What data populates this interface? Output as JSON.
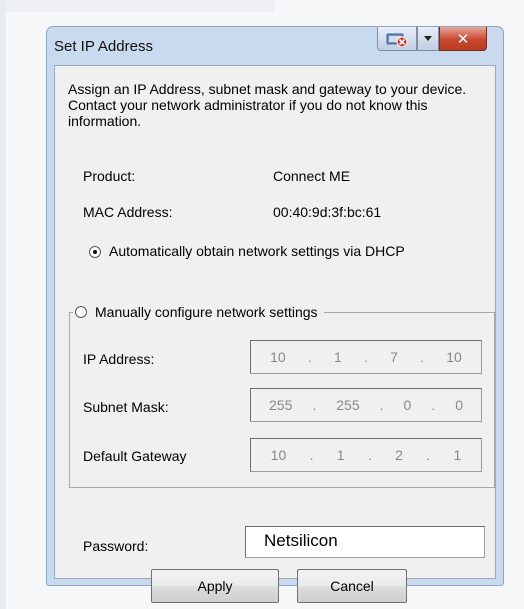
{
  "window": {
    "title": "Set IP Address"
  },
  "description": "Assign an IP Address, subnet mask and gateway to your device.  Contact your network administrator if you do not know this information.",
  "device": {
    "product_label": "Product:",
    "product_value": "Connect ME",
    "mac_label": "MAC Address:",
    "mac_value": "00:40:9d:3f:bc:61"
  },
  "dhcp_option": {
    "label": "Automatically obtain network settings via DHCP",
    "checked": true
  },
  "manual_option": {
    "label": "Manually configure network settings",
    "checked": false
  },
  "network": {
    "ip_label": "IP Address:",
    "ip_octets": [
      "10",
      "1",
      "7",
      "10"
    ],
    "subnet_label": "Subnet Mask:",
    "subnet_octets": [
      "255",
      "255",
      "0",
      "0"
    ],
    "gateway_label": "Default Gateway",
    "gateway_octets": [
      "10",
      "1",
      "2",
      "1"
    ]
  },
  "password": {
    "label": "Password:",
    "value": "Netsilicon"
  },
  "buttons": {
    "apply": "Apply",
    "cancel": "Cancel"
  },
  "icons": {
    "disconnect": "network-disconnect-icon",
    "dropdown": "dropdown-arrow-icon",
    "close": "close-icon"
  },
  "colors": {
    "close_button": "#c9472f",
    "title_bar": "#c9d9ee"
  }
}
